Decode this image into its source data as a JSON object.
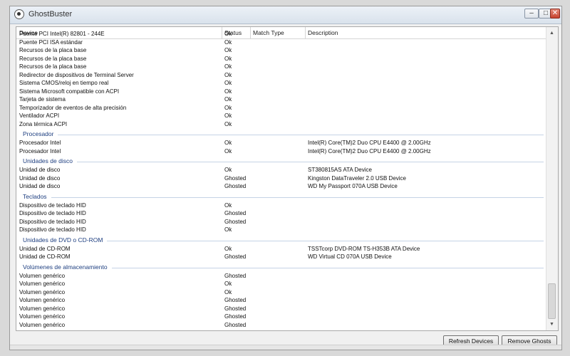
{
  "window": {
    "title": "GhostBuster"
  },
  "columns": {
    "device": "Device",
    "status": "Status",
    "match_type": "Match Type",
    "description": "Description"
  },
  "rows_top": [
    {
      "device": "Puente PCI Intel(R) 82801 - 244E",
      "status": "Ok",
      "description": ""
    },
    {
      "device": "Puente PCI ISA estándar",
      "status": "Ok",
      "description": ""
    },
    {
      "device": "Recursos de la placa base",
      "status": "Ok",
      "description": ""
    },
    {
      "device": "Recursos de la placa base",
      "status": "Ok",
      "description": ""
    },
    {
      "device": "Recursos de la placa base",
      "status": "Ok",
      "description": ""
    },
    {
      "device": "Redirector de dispositivos de Terminal Server",
      "status": "Ok",
      "description": ""
    },
    {
      "device": "Sistema CMOS/reloj en tiempo real",
      "status": "Ok",
      "description": ""
    },
    {
      "device": "Sistema Microsoft compatible con ACPI",
      "status": "Ok",
      "description": ""
    },
    {
      "device": "Tarjeta de sistema",
      "status": "Ok",
      "description": ""
    },
    {
      "device": "Temporizador de eventos de alta precisión",
      "status": "Ok",
      "description": ""
    },
    {
      "device": "Ventilador ACPI",
      "status": "Ok",
      "description": ""
    },
    {
      "device": "Zona térmica ACPI",
      "status": "Ok",
      "description": ""
    }
  ],
  "groups": [
    {
      "label": "Procesador",
      "rows": [
        {
          "device": "Procesador Intel",
          "status": "Ok",
          "description": "Intel(R) Core(TM)2 Duo CPU     E4400  @ 2.00GHz"
        },
        {
          "device": "Procesador Intel",
          "status": "Ok",
          "description": "Intel(R) Core(TM)2 Duo CPU     E4400  @ 2.00GHz"
        }
      ]
    },
    {
      "label": "Unidades de disco",
      "rows": [
        {
          "device": "Unidad de disco",
          "status": "Ok",
          "description": "ST380815AS ATA Device"
        },
        {
          "device": "Unidad de disco",
          "status": "Ghosted",
          "description": "Kingston DataTraveler 2.0 USB Device"
        },
        {
          "device": "Unidad de disco",
          "status": "Ghosted",
          "description": "WD My Passport 070A USB Device"
        }
      ]
    },
    {
      "label": "Teclados",
      "rows": [
        {
          "device": "Dispositivo de teclado HID",
          "status": "Ok",
          "description": ""
        },
        {
          "device": "Dispositivo de teclado HID",
          "status": "Ghosted",
          "description": ""
        },
        {
          "device": "Dispositivo de teclado HID",
          "status": "Ghosted",
          "description": ""
        },
        {
          "device": "Dispositivo de teclado HID",
          "status": "Ok",
          "description": ""
        }
      ]
    },
    {
      "label": "Unidades de DVD o CD-ROM",
      "rows": [
        {
          "device": "Unidad de CD-ROM",
          "status": "Ok",
          "description": "TSSTcorp DVD-ROM TS-H353B ATA Device"
        },
        {
          "device": "Unidad de CD-ROM",
          "status": "Ghosted",
          "description": "WD Virtual CD 070A USB Device"
        }
      ]
    },
    {
      "label": "Volúmenes de almacenamiento",
      "rows": [
        {
          "device": "Volumen genérico",
          "status": "Ghosted",
          "description": ""
        },
        {
          "device": "Volumen genérico",
          "status": "Ok",
          "description": ""
        },
        {
          "device": "Volumen genérico",
          "status": "Ok",
          "description": ""
        },
        {
          "device": "Volumen genérico",
          "status": "Ghosted",
          "description": ""
        },
        {
          "device": "Volumen genérico",
          "status": "Ghosted",
          "description": ""
        },
        {
          "device": "Volumen genérico",
          "status": "Ghosted",
          "description": ""
        },
        {
          "device": "Volumen genérico",
          "status": "Ghosted",
          "description": ""
        }
      ]
    }
  ],
  "buttons": {
    "refresh": "Refresh Devices",
    "remove": "Remove Ghosts"
  },
  "icons": {
    "app": "ghost-icon",
    "minimize": "minimize-icon",
    "maximize": "maximize-icon",
    "close": "close-icon",
    "scroll_up": "chevron-up-icon",
    "scroll_down": "chevron-down-icon"
  },
  "colors": {
    "group_label": "#1e3f80",
    "group_line": "#c5d3e6"
  }
}
